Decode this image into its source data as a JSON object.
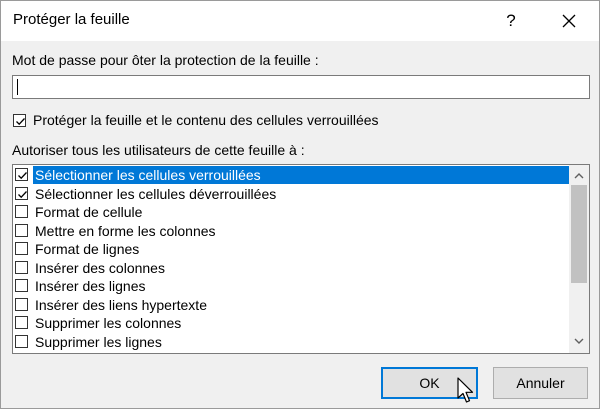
{
  "dialog": {
    "title": "Protéger la feuille",
    "help_label": "?",
    "password_label": "Mot de passe pour ôter la protection de la feuille :",
    "password_value": "",
    "protect_checkbox_label": "Protéger la feuille et le contenu des cellules verrouillées",
    "protect_checked": true,
    "permissions_label": "Autoriser tous les utilisateurs de cette feuille à :",
    "permissions": [
      {
        "label": "Sélectionner les cellules verrouillées",
        "checked": true,
        "selected": true
      },
      {
        "label": "Sélectionner les cellules déverrouillées",
        "checked": true,
        "selected": false
      },
      {
        "label": "Format de cellule",
        "checked": false,
        "selected": false
      },
      {
        "label": "Mettre en forme les colonnes",
        "checked": false,
        "selected": false
      },
      {
        "label": "Format de lignes",
        "checked": false,
        "selected": false
      },
      {
        "label": "Insérer des colonnes",
        "checked": false,
        "selected": false
      },
      {
        "label": "Insérer des lignes",
        "checked": false,
        "selected": false
      },
      {
        "label": "Insérer des liens hypertexte",
        "checked": false,
        "selected": false
      },
      {
        "label": "Supprimer les colonnes",
        "checked": false,
        "selected": false
      },
      {
        "label": "Supprimer les lignes",
        "checked": false,
        "selected": false
      }
    ],
    "ok_label": "OK",
    "cancel_label": "Annuler"
  },
  "colors": {
    "selection": "#0078d7",
    "dialog_bg": "#f0f0f0",
    "button_bg": "#e1e1e1"
  },
  "icons": {
    "close": "close-icon",
    "check": "checkmark-icon",
    "scroll_up": "chevron-up-icon",
    "scroll_down": "chevron-down-icon",
    "cursor": "mouse-pointer-icon"
  }
}
